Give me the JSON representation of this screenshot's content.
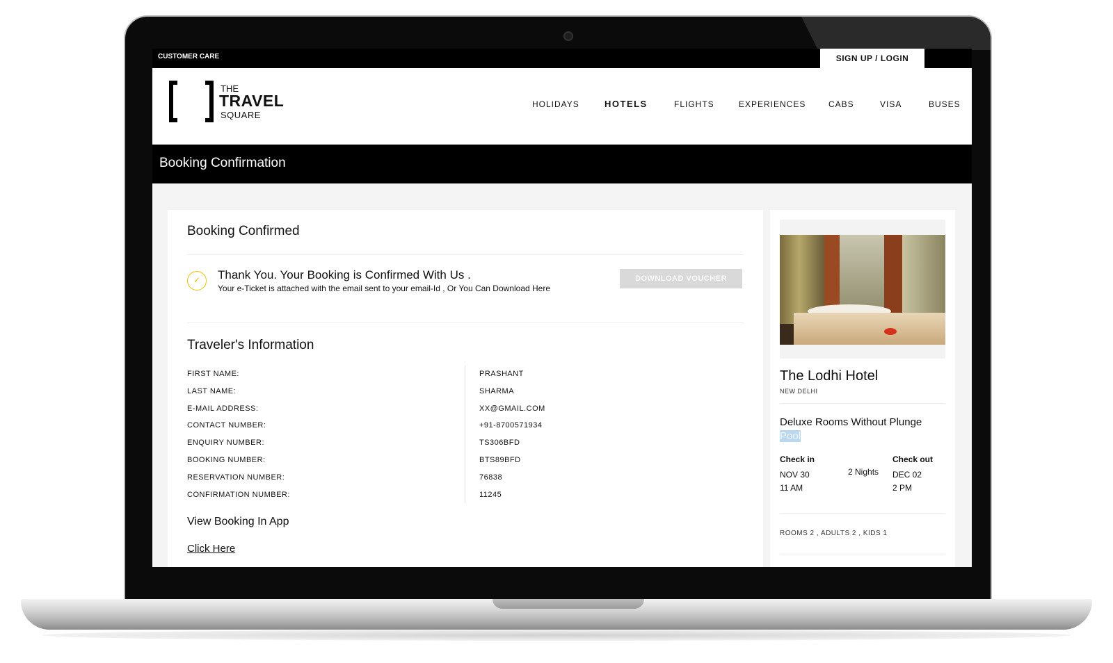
{
  "topbar": {
    "customer_care": "CUSTOMER CARE",
    "signup_login": "SIGN UP / LOGIN"
  },
  "logo": {
    "line1": "THE",
    "line2": "TRAVEL",
    "line3": "SQUARE"
  },
  "nav": [
    "HOLIDAYS",
    "HOTELS",
    "FLIGHTS",
    "EXPERIENCES",
    "CABS",
    "VISA",
    "BUSES"
  ],
  "nav_active": "HOTELS",
  "page_title": "Booking Confirmation",
  "confirmation": {
    "heading": "Booking Confirmed",
    "check_icon": "check-icon",
    "thank_you": "Thank You. Your Booking is Confirmed With Us .",
    "eticket_note": "Your e-Ticket is attached with the email sent to your email-Id , Or You Can Download Here",
    "download_label": "DOWNLOAD VOUCHER"
  },
  "traveler": {
    "heading": "Traveler's Information",
    "rows": [
      {
        "label": "FIRST NAME:",
        "value": "PRASHANT"
      },
      {
        "label": "LAST NAME:",
        "value": "SHARMA"
      },
      {
        "label": "E-MAIL ADDRESS:",
        "value": "XX@GMAIL.COM"
      },
      {
        "label": "CONTACT NUMBER:",
        "value": "+91-8700571934"
      },
      {
        "label": "ENQUIRY NUMBER:",
        "value": "TS306BFD"
      },
      {
        "label": "BOOKING NUMBER:",
        "value": "BTS89BFD"
      },
      {
        "label": "RESERVATION NUMBER:",
        "value": "76838"
      },
      {
        "label": "CONFIRMATION NUMBER:",
        "value": "11245"
      }
    ],
    "view_app": "View Booking In App",
    "click_here": "Click Here"
  },
  "hotel": {
    "name": "The Lodhi Hotel",
    "city": "NEW DELHI",
    "room_type_main": "Deluxe Rooms Without Plunge",
    "room_type_highlight": "Pool",
    "checkin_label": "Check in",
    "checkout_label": "Check out",
    "nights": "2 Nights",
    "checkin_date": "NOV 30",
    "checkin_time": "11 AM",
    "checkout_date": "DEC 02",
    "checkout_time": "2 PM",
    "guests": "ROOMS  2 , ADULTS  2 , KIDS  1"
  },
  "colors": {
    "accent": "#f0c000",
    "header_bg": "#000000",
    "page_bg": "#f4f4f4",
    "highlight": "#b9d8f0"
  }
}
